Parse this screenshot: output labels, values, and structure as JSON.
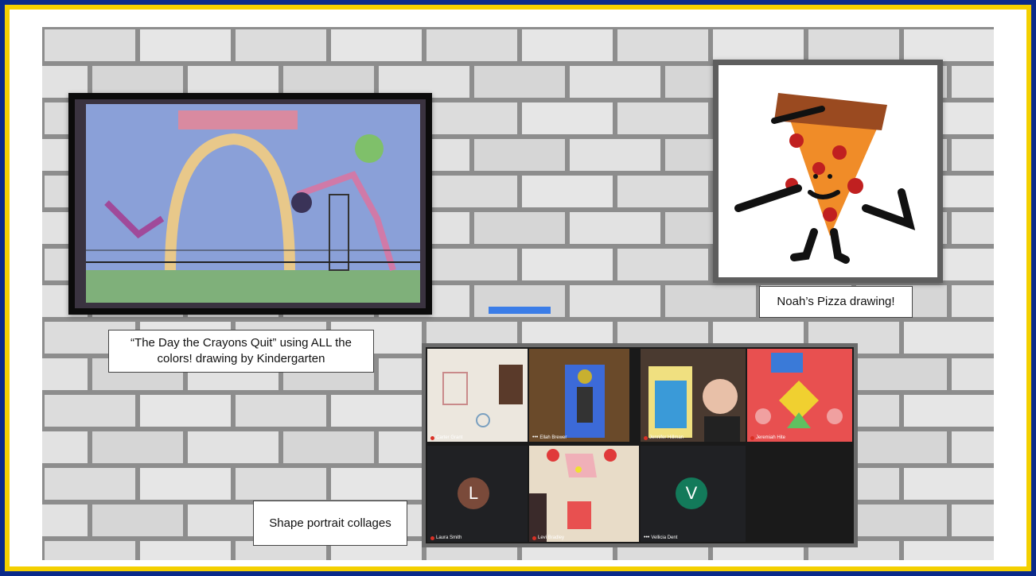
{
  "captions": {
    "crayons": "“The Day the Crayons Quit” using ALL the colors! drawing by Kindergarten",
    "pizza": "Noah’s Pizza drawing!",
    "collages": "Shape portrait collages"
  },
  "meet": {
    "participants": [
      {
        "name": "Carter Grant"
      },
      {
        "name": "Ellah Brewer"
      },
      {
        "name": "Jennifer Hillman"
      },
      {
        "name": "Jeremiah Hite"
      },
      {
        "name": "Laura Smith",
        "initial": "L"
      },
      {
        "name": "Levi Bradley"
      },
      {
        "name": "Vellicia Dent",
        "initial": "V"
      }
    ]
  },
  "colors": {
    "outer_border": "#0a2a8a",
    "yellow_border": "#f4d000",
    "accent_bar": "#3b7de8",
    "avatar_L": "#7a4a3a",
    "avatar_V": "#137a5a"
  }
}
